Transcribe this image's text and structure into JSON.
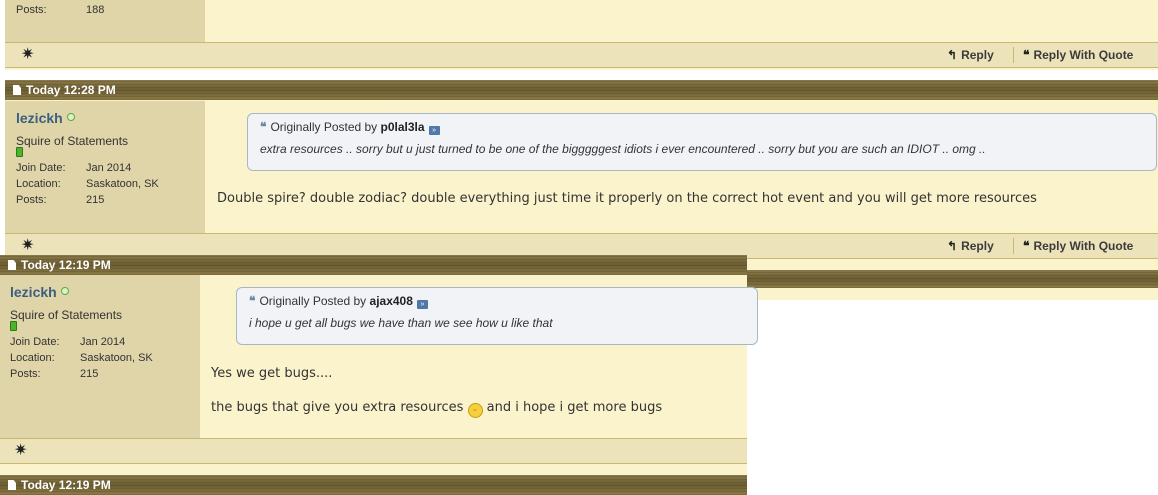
{
  "top_post": {
    "stat_label": "Posts:",
    "stat_value": "188",
    "actions": {
      "reply": "Reply",
      "reply_with_quote": "Reply With Quote"
    }
  },
  "post_2": {
    "timestamp": "Today 12:28 PM",
    "user": {
      "name": "lezickh",
      "title": "Squire of Statements",
      "stats": [
        {
          "label": "Join Date:",
          "value": "Jan 2014"
        },
        {
          "label": "Location:",
          "value": "Saskatoon, SK"
        },
        {
          "label": "Posts:",
          "value": "215"
        }
      ]
    },
    "quote": {
      "prefix": "Originally Posted by",
      "author": "p0lal3la",
      "text": "extra resources .. sorry but u just turned to be one of the bigggggest idiots i ever encountered .. sorry but you are such an IDIOT .. omg .."
    },
    "message": "Double spire? double zodiac? double everything just time it properly on the correct hot event and you will get more resources",
    "actions": {
      "reply": "Reply",
      "reply_with_quote": "Reply With Quote"
    }
  },
  "post_3": {
    "timestamp": "Today 12:19 PM",
    "user": {
      "name": "lezickh",
      "title": "Squire of Statements",
      "stats": [
        {
          "label": "Join Date:",
          "value": "Jan 2014"
        },
        {
          "label": "Location:",
          "value": "Saskatoon, SK"
        },
        {
          "label": "Posts:",
          "value": "215"
        }
      ]
    },
    "quote": {
      "prefix": "Originally Posted by",
      "author": "ajax408",
      "text": "i hope u get all bugs we have than we see how u like that"
    },
    "message_line1": "Yes we get bugs....",
    "message_line2_before": "the bugs that give you extra resources",
    "message_line2_after": "and i hope i get more bugs"
  },
  "post_4": {
    "timestamp": "Today 12:19 PM"
  }
}
